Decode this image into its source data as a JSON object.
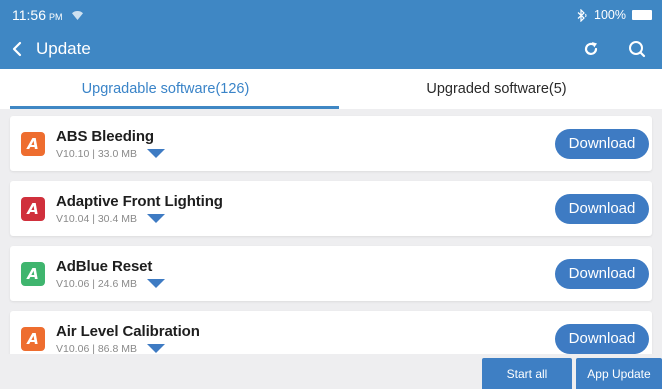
{
  "status_bar": {
    "time": "11:56",
    "ampm": "PM",
    "battery": "100%"
  },
  "header": {
    "title": "Update",
    "icons": [
      "back-arrow-icon",
      "refresh-icon",
      "search-icon"
    ]
  },
  "tabs": [
    {
      "label": "Upgradable software(126)",
      "active": true
    },
    {
      "label": "Upgraded software(5)",
      "active": false
    }
  ],
  "items": [
    {
      "name": "ABS Bleeding",
      "meta": "V10.10 | 33.0 MB",
      "icon_letter": "A",
      "icon_color": "#ee6d2f",
      "button": "Download"
    },
    {
      "name": "Adaptive Front Lighting",
      "meta": "V10.04 | 30.4 MB",
      "icon_letter": "A",
      "icon_color": "#d0303c",
      "button": "Download"
    },
    {
      "name": "AdBlue Reset",
      "meta": "V10.06 | 24.6 MB",
      "icon_letter": "A",
      "icon_color": "#3fb56e",
      "button": "Download"
    },
    {
      "name": "Air Level Calibration",
      "meta": "V10.06 | 86.8 MB",
      "icon_letter": "A",
      "icon_color": "#ee6d2f",
      "button": "Download"
    }
  ],
  "bottom_bar": {
    "start_all": "Start all",
    "app_update": "App Update"
  },
  "colors": {
    "header": "#3f87c4",
    "accent": "#3e7bc3",
    "background": "#eeeef0"
  }
}
